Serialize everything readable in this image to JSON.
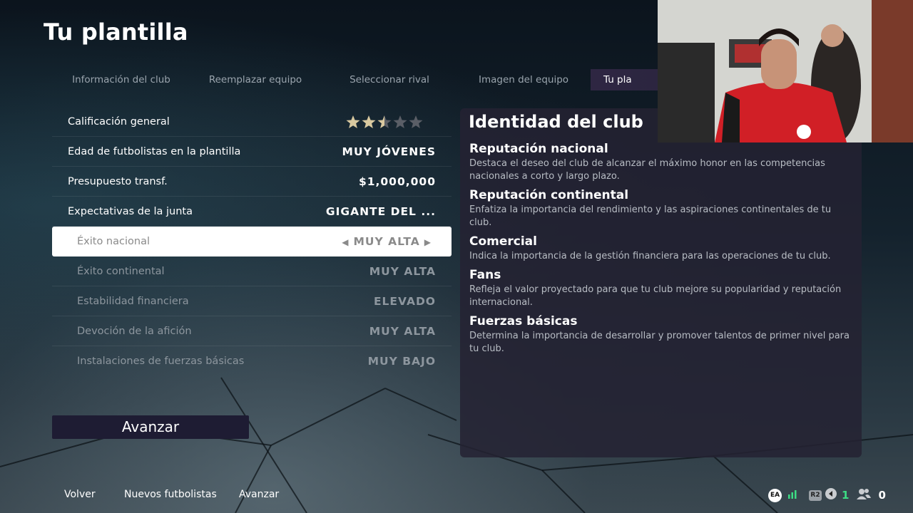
{
  "page": {
    "title": "Tu plantilla"
  },
  "tabs": [
    {
      "label": "Información del club",
      "active": false
    },
    {
      "label": "Reemplazar equipo",
      "active": false
    },
    {
      "label": "Seleccionar rival",
      "active": false
    },
    {
      "label": "Imagen del equipo",
      "active": false
    },
    {
      "label": "Tu pla",
      "active": true
    }
  ],
  "settings": {
    "overall": {
      "label": "Calificación general",
      "stars_filled": 2.5,
      "stars_total": 5
    },
    "age": {
      "label": "Edad de futbolistas en la plantilla",
      "value": "MUY JÓVENES"
    },
    "budget": {
      "label": "Presupuesto transf.",
      "value": "$1,000,000"
    },
    "board": {
      "label": "Expectativas de la junta",
      "value": "GIGANTE DEL ..."
    },
    "sub_items": [
      {
        "label": "Éxito nacional",
        "value": "MUY ALTA",
        "selected": true
      },
      {
        "label": "Éxito continental",
        "value": "MUY ALTA",
        "selected": false
      },
      {
        "label": "Estabilidad financiera",
        "value": "ELEVADO",
        "selected": false
      },
      {
        "label": "Devoción de la afición",
        "value": "MUY ALTA",
        "selected": false
      },
      {
        "label": "Instalaciones de fuerzas básicas",
        "value": "MUY BAJO",
        "selected": false
      }
    ]
  },
  "advance_button": {
    "label": "Avanzar"
  },
  "panel": {
    "title": "Identidad del club",
    "items": [
      {
        "heading": "Reputación nacional",
        "text": "Destaca el deseo del club de alcanzar el máximo honor en las competencias nacionales a corto y largo plazo."
      },
      {
        "heading": "Reputación continental",
        "text": "Enfatiza la importancia del rendimiento y las aspiraciones continentales de tu club."
      },
      {
        "heading": "Comercial",
        "text": "Indica la importancia de la gestión financiera para las operaciones de tu club."
      },
      {
        "heading": "Fans",
        "text": "Refleja el valor proyectado para que tu club mejore su popularidad y reputación internacional."
      },
      {
        "heading": "Fuerzas básicas",
        "text": "Determina la importancia de desarrollar y promover talentos de primer nivel para tu club."
      }
    ]
  },
  "footer": {
    "buttons": [
      "Volver",
      "Nuevos futbolistas",
      "Avanzar"
    ],
    "ea_label": "EA",
    "r2_label": "R2",
    "notifications_count": "1",
    "friends_count": "0"
  },
  "colors": {
    "accent_green": "#3ddc84",
    "panel_bg": "#242232",
    "selected_row": "#ffffff",
    "button_bg": "#1e1c33"
  },
  "icons": [
    "ea-logo-icon",
    "signal-icon",
    "r2-icon",
    "speaker-icon",
    "friends-icon",
    "arrow-left-icon",
    "arrow-right-icon",
    "star-icon"
  ]
}
